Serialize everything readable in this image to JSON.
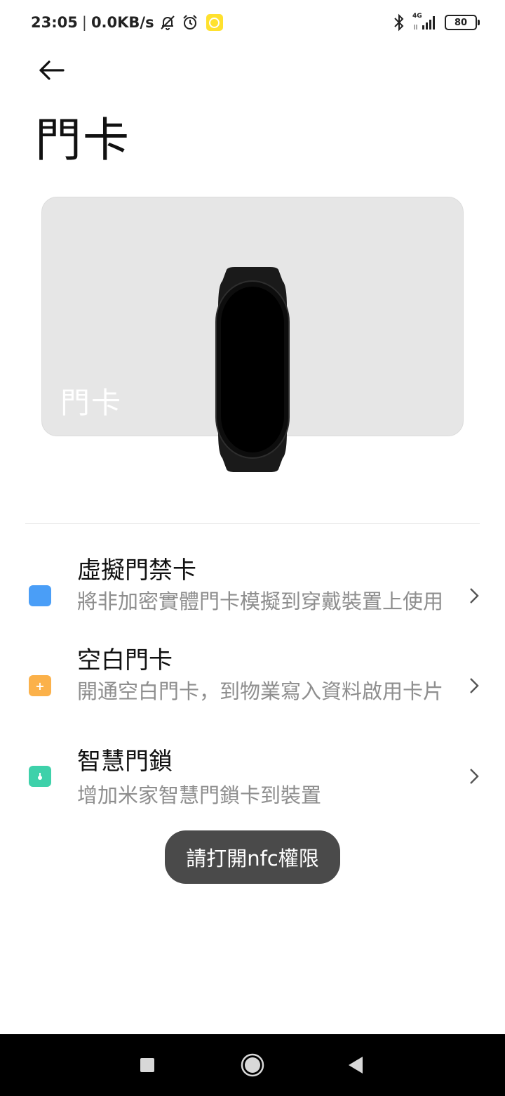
{
  "status_bar": {
    "time": "23:05",
    "separator": "|",
    "net_speed": "0.0KB/s",
    "network": "4G",
    "battery": "80",
    "icons": [
      "bell-off-icon",
      "alarm-icon",
      "app-notification-icon",
      "bluetooth-icon",
      "signal-icon",
      "battery-icon"
    ]
  },
  "header": {
    "title": "門卡",
    "back_icon": "arrow-left-icon"
  },
  "card": {
    "label": "門卡",
    "image": "smart-band-image"
  },
  "list": [
    {
      "title": "虛擬門禁卡",
      "subtitle": "將非加密實體門卡模擬到穿戴裝置上使用",
      "icon": "card-icon",
      "color": "#4a9ef7"
    },
    {
      "title": "空白門卡",
      "subtitle": "開通空白門卡，到物業寫入資料啟用卡片",
      "icon": "add-card-icon",
      "color": "#fbb14a"
    },
    {
      "title": "智慧門鎖",
      "subtitle": "增加米家智慧門鎖卡到裝置",
      "icon": "door-lock-icon",
      "color": "#3ed1aa"
    }
  ],
  "toast": {
    "text": "請打開nfc權限"
  },
  "nav_bar": {
    "buttons": [
      "recents-icon",
      "home-icon",
      "back-icon"
    ]
  }
}
